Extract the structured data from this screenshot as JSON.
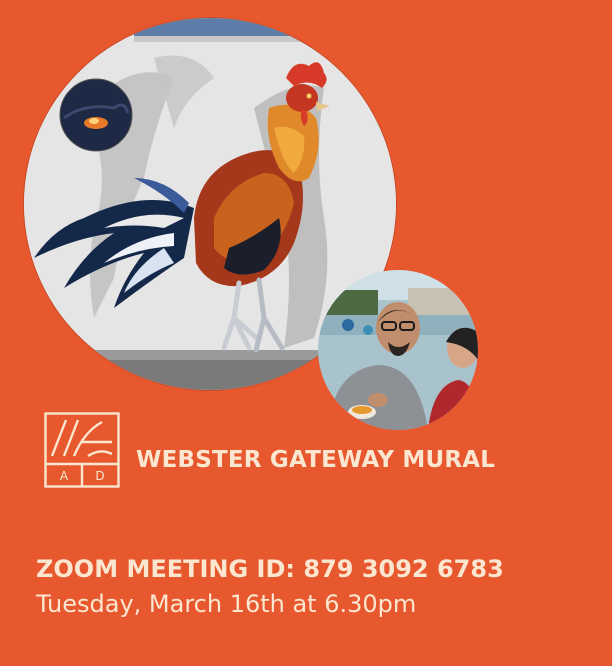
{
  "colors": {
    "background": "#e8582f",
    "text": "#fbe6cf"
  },
  "logo": {
    "letters": "AD"
  },
  "mural": {
    "title": "WEBSTER GATEWAY MURAL"
  },
  "meeting": {
    "id_line": "ZOOM MEETING ID: 879 3092 6783",
    "time_line": "Tuesday, March 16th at 6.30pm"
  }
}
